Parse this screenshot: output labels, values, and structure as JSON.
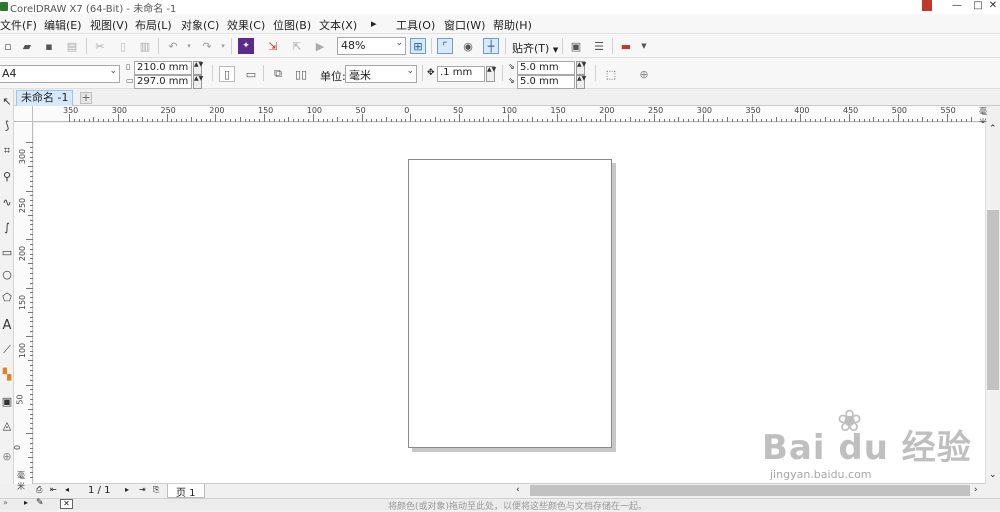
{
  "app": {
    "title": "CorelDRAW X7 (64-Bit) - 未命名 -1"
  },
  "window_buttons": [
    "—",
    "□",
    "✕"
  ],
  "menu": [
    {
      "label": "文件(F)"
    },
    {
      "label": "编辑(E)"
    },
    {
      "label": "视图(V)"
    },
    {
      "label": "布局(L)"
    },
    {
      "label": "对象(C)"
    },
    {
      "label": "效果(C)"
    },
    {
      "label": "位图(B)"
    },
    {
      "label": "文本(X)"
    },
    {
      "label": "▸"
    },
    {
      "label": "工具(O)"
    },
    {
      "label": "窗口(W)"
    },
    {
      "label": "帮助(H)"
    }
  ],
  "toolbar": {
    "zoom": "48%",
    "snap_label": "贴齐(T)"
  },
  "property_bar": {
    "page_size": "A4",
    "width": "210.0 mm",
    "height": "297.0 mm",
    "unit_label": "单位:",
    "unit_value": "毫米",
    "nudge": ".1 mm",
    "dup_x": "5.0 mm",
    "dup_y": "5.0 mm"
  },
  "tabs": {
    "doc_tab": "未命名 -1",
    "add": "+"
  },
  "ruler": {
    "h_labels": [
      "350",
      "300",
      "250",
      "200",
      "150",
      "100",
      "50",
      "0",
      "50",
      "100",
      "150",
      "200",
      "250",
      "300",
      "350",
      "400",
      "450",
      "500",
      "550"
    ],
    "h_unit": "毫米",
    "v_labels": [
      "300",
      "250",
      "200",
      "150",
      "100",
      "50",
      "0"
    ],
    "v_unit": "毫米"
  },
  "page_nav": {
    "counter": "1 / 1",
    "page_tab": "页 1"
  },
  "status": {
    "hint": "将颜色(或对象)拖动至此处，以便将这些颜色与文档存储在一起。"
  },
  "watermark": {
    "brand": "Bai du 经验",
    "url": "jingyan.baidu.com"
  },
  "icons": {
    "toolbox": [
      "pick-tool-icon",
      "shape-tool-icon",
      "crop-tool-icon",
      "zoom-tool-icon",
      "freehand-tool-icon",
      "artistic-media-icon",
      "rectangle-tool-icon",
      "ellipse-tool-icon",
      "polygon-tool-icon",
      "text-tool-icon",
      "parallel-dimension-icon",
      "connector-icon",
      "drop-shadow-icon",
      "interactive-fill-icon",
      "add-tool-icon"
    ]
  }
}
